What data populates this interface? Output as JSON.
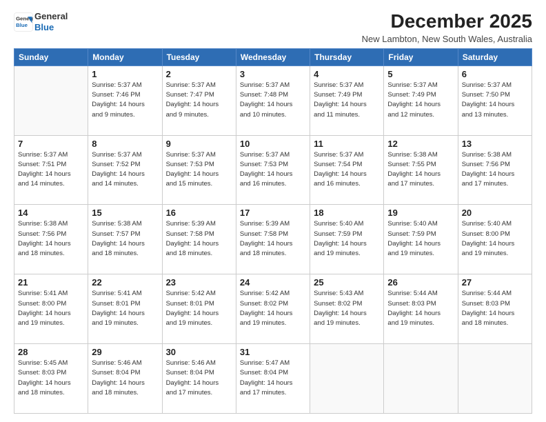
{
  "header": {
    "logo_line1": "General",
    "logo_line2": "Blue",
    "month_title": "December 2025",
    "location": "New Lambton, New South Wales, Australia"
  },
  "days_of_week": [
    "Sunday",
    "Monday",
    "Tuesday",
    "Wednesday",
    "Thursday",
    "Friday",
    "Saturday"
  ],
  "weeks": [
    [
      {
        "day": "",
        "info": ""
      },
      {
        "day": "1",
        "info": "Sunrise: 5:37 AM\nSunset: 7:46 PM\nDaylight: 14 hours\nand 9 minutes."
      },
      {
        "day": "2",
        "info": "Sunrise: 5:37 AM\nSunset: 7:47 PM\nDaylight: 14 hours\nand 9 minutes."
      },
      {
        "day": "3",
        "info": "Sunrise: 5:37 AM\nSunset: 7:48 PM\nDaylight: 14 hours\nand 10 minutes."
      },
      {
        "day": "4",
        "info": "Sunrise: 5:37 AM\nSunset: 7:49 PM\nDaylight: 14 hours\nand 11 minutes."
      },
      {
        "day": "5",
        "info": "Sunrise: 5:37 AM\nSunset: 7:49 PM\nDaylight: 14 hours\nand 12 minutes."
      },
      {
        "day": "6",
        "info": "Sunrise: 5:37 AM\nSunset: 7:50 PM\nDaylight: 14 hours\nand 13 minutes."
      }
    ],
    [
      {
        "day": "7",
        "info": "Sunrise: 5:37 AM\nSunset: 7:51 PM\nDaylight: 14 hours\nand 14 minutes."
      },
      {
        "day": "8",
        "info": "Sunrise: 5:37 AM\nSunset: 7:52 PM\nDaylight: 14 hours\nand 14 minutes."
      },
      {
        "day": "9",
        "info": "Sunrise: 5:37 AM\nSunset: 7:53 PM\nDaylight: 14 hours\nand 15 minutes."
      },
      {
        "day": "10",
        "info": "Sunrise: 5:37 AM\nSunset: 7:53 PM\nDaylight: 14 hours\nand 16 minutes."
      },
      {
        "day": "11",
        "info": "Sunrise: 5:37 AM\nSunset: 7:54 PM\nDaylight: 14 hours\nand 16 minutes."
      },
      {
        "day": "12",
        "info": "Sunrise: 5:38 AM\nSunset: 7:55 PM\nDaylight: 14 hours\nand 17 minutes."
      },
      {
        "day": "13",
        "info": "Sunrise: 5:38 AM\nSunset: 7:56 PM\nDaylight: 14 hours\nand 17 minutes."
      }
    ],
    [
      {
        "day": "14",
        "info": "Sunrise: 5:38 AM\nSunset: 7:56 PM\nDaylight: 14 hours\nand 18 minutes."
      },
      {
        "day": "15",
        "info": "Sunrise: 5:38 AM\nSunset: 7:57 PM\nDaylight: 14 hours\nand 18 minutes."
      },
      {
        "day": "16",
        "info": "Sunrise: 5:39 AM\nSunset: 7:58 PM\nDaylight: 14 hours\nand 18 minutes."
      },
      {
        "day": "17",
        "info": "Sunrise: 5:39 AM\nSunset: 7:58 PM\nDaylight: 14 hours\nand 18 minutes."
      },
      {
        "day": "18",
        "info": "Sunrise: 5:40 AM\nSunset: 7:59 PM\nDaylight: 14 hours\nand 19 minutes."
      },
      {
        "day": "19",
        "info": "Sunrise: 5:40 AM\nSunset: 7:59 PM\nDaylight: 14 hours\nand 19 minutes."
      },
      {
        "day": "20",
        "info": "Sunrise: 5:40 AM\nSunset: 8:00 PM\nDaylight: 14 hours\nand 19 minutes."
      }
    ],
    [
      {
        "day": "21",
        "info": "Sunrise: 5:41 AM\nSunset: 8:00 PM\nDaylight: 14 hours\nand 19 minutes."
      },
      {
        "day": "22",
        "info": "Sunrise: 5:41 AM\nSunset: 8:01 PM\nDaylight: 14 hours\nand 19 minutes."
      },
      {
        "day": "23",
        "info": "Sunrise: 5:42 AM\nSunset: 8:01 PM\nDaylight: 14 hours\nand 19 minutes."
      },
      {
        "day": "24",
        "info": "Sunrise: 5:42 AM\nSunset: 8:02 PM\nDaylight: 14 hours\nand 19 minutes."
      },
      {
        "day": "25",
        "info": "Sunrise: 5:43 AM\nSunset: 8:02 PM\nDaylight: 14 hours\nand 19 minutes."
      },
      {
        "day": "26",
        "info": "Sunrise: 5:44 AM\nSunset: 8:03 PM\nDaylight: 14 hours\nand 19 minutes."
      },
      {
        "day": "27",
        "info": "Sunrise: 5:44 AM\nSunset: 8:03 PM\nDaylight: 14 hours\nand 18 minutes."
      }
    ],
    [
      {
        "day": "28",
        "info": "Sunrise: 5:45 AM\nSunset: 8:03 PM\nDaylight: 14 hours\nand 18 minutes."
      },
      {
        "day": "29",
        "info": "Sunrise: 5:46 AM\nSunset: 8:04 PM\nDaylight: 14 hours\nand 18 minutes."
      },
      {
        "day": "30",
        "info": "Sunrise: 5:46 AM\nSunset: 8:04 PM\nDaylight: 14 hours\nand 17 minutes."
      },
      {
        "day": "31",
        "info": "Sunrise: 5:47 AM\nSunset: 8:04 PM\nDaylight: 14 hours\nand 17 minutes."
      },
      {
        "day": "",
        "info": ""
      },
      {
        "day": "",
        "info": ""
      },
      {
        "day": "",
        "info": ""
      }
    ]
  ]
}
